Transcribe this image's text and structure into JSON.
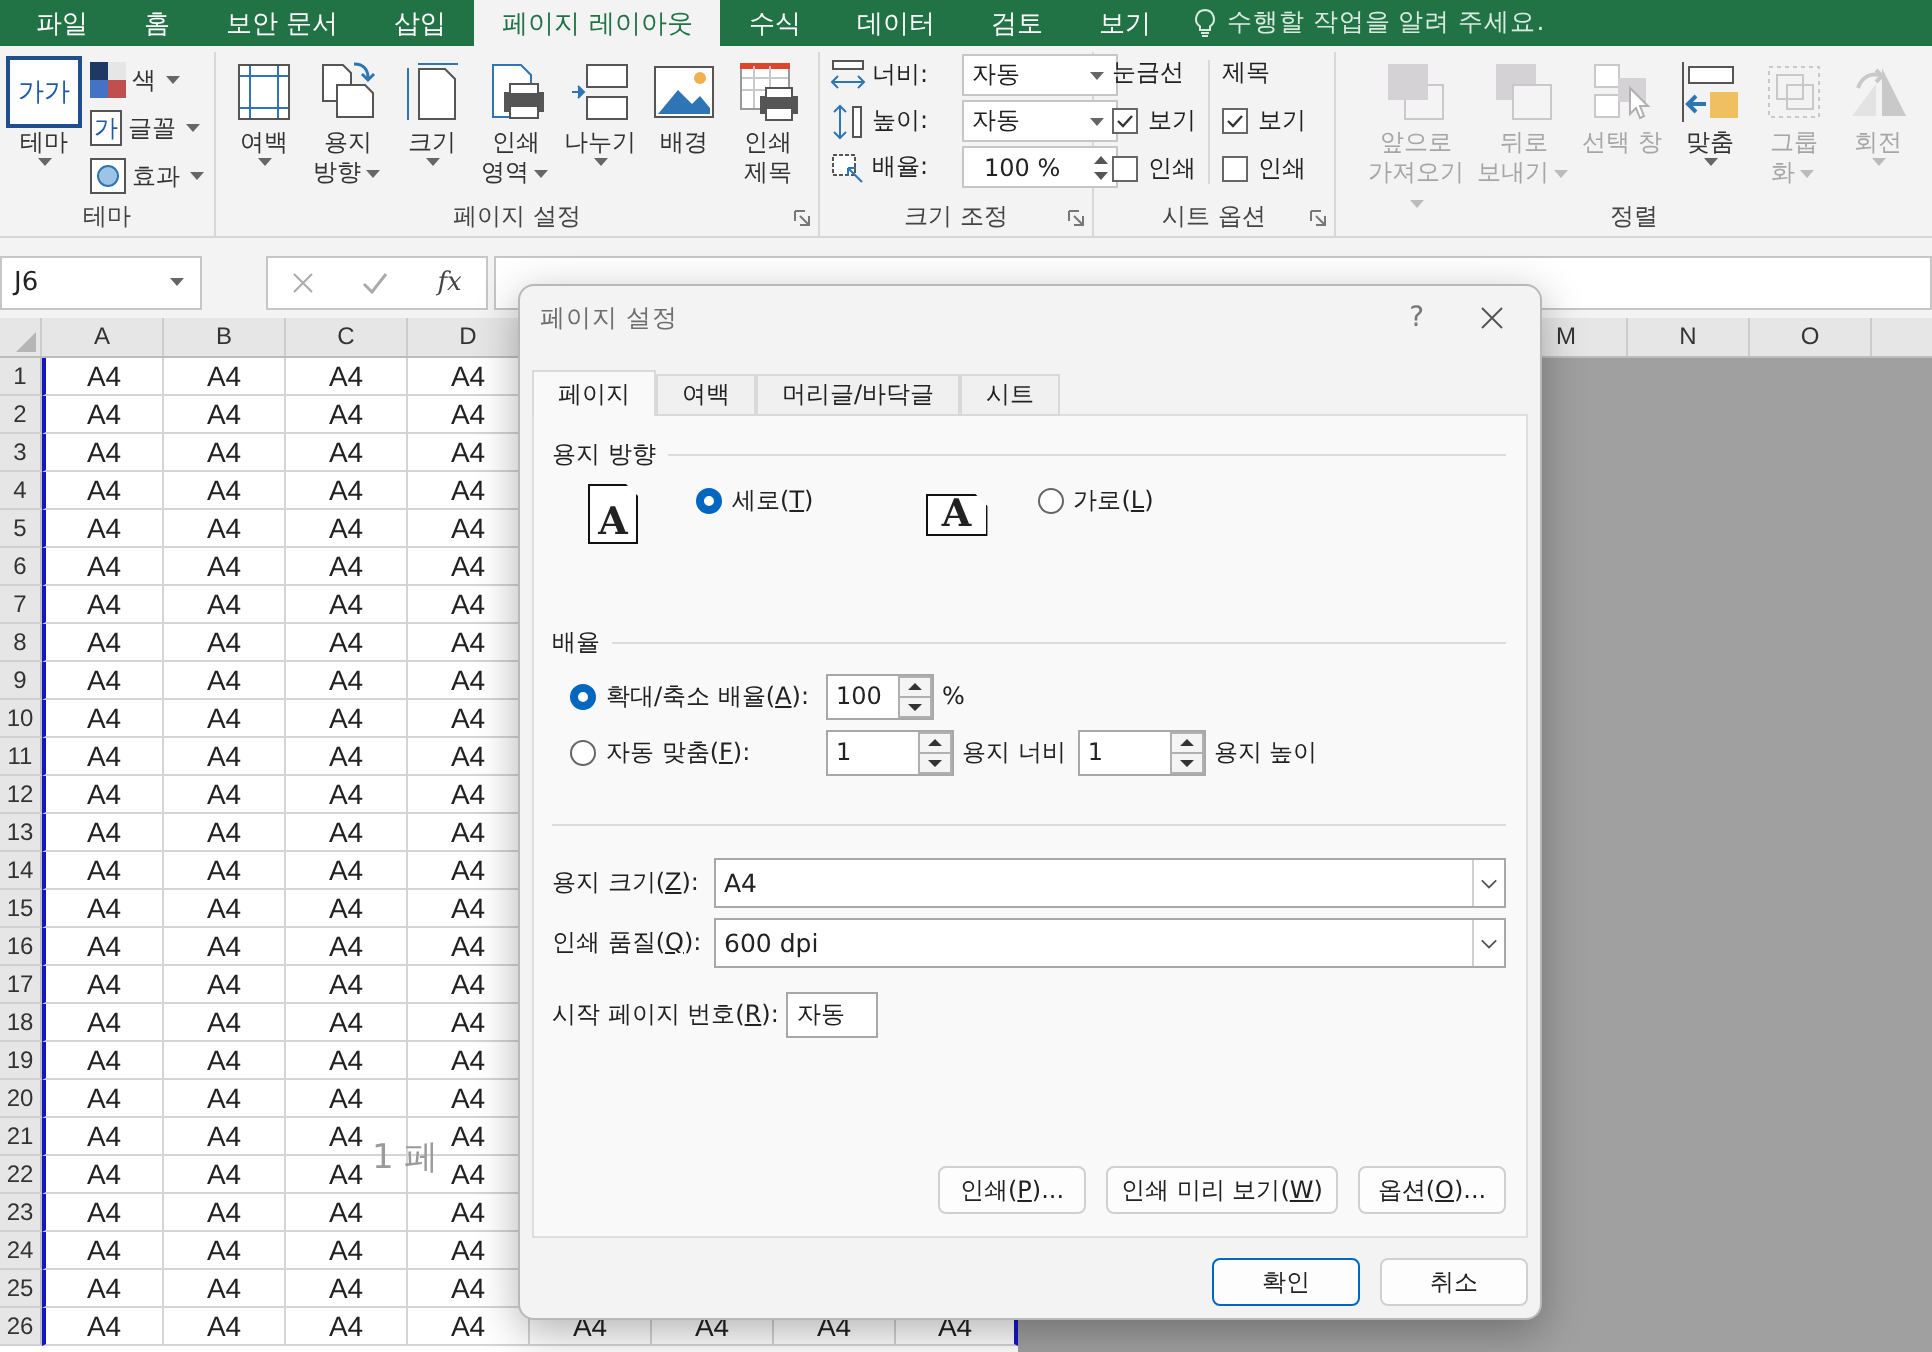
{
  "ribbon_tabs": [
    {
      "label": "파일",
      "selected": false
    },
    {
      "label": "홈",
      "selected": false
    },
    {
      "label": "보안 문서",
      "selected": false
    },
    {
      "label": "삽입",
      "selected": false
    },
    {
      "label": "페이지 레이아웃",
      "selected": true
    },
    {
      "label": "수식",
      "selected": false
    },
    {
      "label": "데이터",
      "selected": false
    },
    {
      "label": "검토",
      "selected": false
    },
    {
      "label": "보기",
      "selected": false
    }
  ],
  "tell_me": "수행할 작업을 알려 주세요.",
  "ribbon": {
    "themes": {
      "title": "테마",
      "main": {
        "label": "테마",
        "icon_text": "가가",
        "dropdown": true
      },
      "options": [
        {
          "label": "색",
          "dropdown": true
        },
        {
          "label": "글꼴",
          "icon_text": "가",
          "dropdown": true
        },
        {
          "label": "효과",
          "dropdown": true
        }
      ]
    },
    "page_setup": {
      "title": "페이지 설정",
      "buttons": [
        {
          "lines": [
            "여백"
          ],
          "dropdown": true
        },
        {
          "lines": [
            "용지",
            "방향"
          ],
          "dropdown": true
        },
        {
          "lines": [
            "크기"
          ],
          "dropdown": true
        },
        {
          "lines": [
            "인쇄",
            "영역"
          ],
          "dropdown": true
        },
        {
          "lines": [
            "나누기"
          ],
          "dropdown": true
        },
        {
          "lines": [
            "배경"
          ],
          "dropdown": false
        },
        {
          "lines": [
            "인쇄",
            "제목"
          ],
          "dropdown": false
        }
      ]
    },
    "scale": {
      "title": "크기 조정",
      "width": {
        "label": "너비:",
        "value": "자동"
      },
      "height": {
        "label": "높이:",
        "value": "자동"
      },
      "zoom": {
        "label": "배율:",
        "value": "100 %"
      }
    },
    "sheet_options": {
      "title": "시트 옵션",
      "columns": [
        {
          "heading": "눈금선",
          "options": [
            {
              "label": "보기",
              "checked": true
            },
            {
              "label": "인쇄",
              "checked": false
            }
          ]
        },
        {
          "heading": "제목",
          "options": [
            {
              "label": "보기",
              "checked": true
            },
            {
              "label": "인쇄",
              "checked": false
            }
          ]
        }
      ]
    },
    "arrange": {
      "title": "정렬",
      "buttons": [
        {
          "lines": [
            "앞으로",
            "가져오기"
          ],
          "dropdown": true,
          "disabled": true
        },
        {
          "lines": [
            "뒤로",
            "보내기"
          ],
          "dropdown": true,
          "disabled": true
        },
        {
          "lines": [
            "선택 창"
          ],
          "dropdown": false,
          "disabled": true
        },
        {
          "lines": [
            "맞춤"
          ],
          "dropdown": true,
          "disabled": false
        },
        {
          "lines": [
            "그룹",
            "화"
          ],
          "dropdown": true,
          "disabled": true
        },
        {
          "lines": [
            "회전"
          ],
          "dropdown": true,
          "disabled": true
        }
      ]
    }
  },
  "sheet": {
    "name_box": "J6",
    "function_label": "fx",
    "column_headers": {
      "left": [
        "A",
        "B",
        "C",
        "D"
      ],
      "right": [
        "M",
        "N",
        "O"
      ]
    },
    "page_label": "1 페",
    "rows": [
      {
        "number": "1",
        "cells": [
          "A4",
          "A4",
          "A4",
          "A4"
        ]
      },
      {
        "number": "2",
        "cells": [
          "A4",
          "A4",
          "A4",
          "A4"
        ]
      },
      {
        "number": "3",
        "cells": [
          "A4",
          "A4",
          "A4",
          "A4"
        ]
      },
      {
        "number": "4",
        "cells": [
          "A4",
          "A4",
          "A4",
          "A4"
        ]
      },
      {
        "number": "5",
        "cells": [
          "A4",
          "A4",
          "A4",
          "A4"
        ]
      },
      {
        "number": "6",
        "cells": [
          "A4",
          "A4",
          "A4",
          "A4"
        ]
      },
      {
        "number": "7",
        "cells": [
          "A4",
          "A4",
          "A4",
          "A4"
        ]
      },
      {
        "number": "8",
        "cells": [
          "A4",
          "A4",
          "A4",
          "A4"
        ]
      },
      {
        "number": "9",
        "cells": [
          "A4",
          "A4",
          "A4",
          "A4"
        ]
      },
      {
        "number": "10",
        "cells": [
          "A4",
          "A4",
          "A4",
          "A4"
        ]
      },
      {
        "number": "11",
        "cells": [
          "A4",
          "A4",
          "A4",
          "A4"
        ]
      },
      {
        "number": "12",
        "cells": [
          "A4",
          "A4",
          "A4",
          "A4"
        ]
      },
      {
        "number": "13",
        "cells": [
          "A4",
          "A4",
          "A4",
          "A4"
        ]
      },
      {
        "number": "14",
        "cells": [
          "A4",
          "A4",
          "A4",
          "A4"
        ]
      },
      {
        "number": "15",
        "cells": [
          "A4",
          "A4",
          "A4",
          "A4"
        ]
      },
      {
        "number": "16",
        "cells": [
          "A4",
          "A4",
          "A4",
          "A4"
        ]
      },
      {
        "number": "17",
        "cells": [
          "A4",
          "A4",
          "A4",
          "A4"
        ]
      },
      {
        "number": "18",
        "cells": [
          "A4",
          "A4",
          "A4",
          "A4"
        ]
      },
      {
        "number": "19",
        "cells": [
          "A4",
          "A4",
          "A4",
          "A4"
        ]
      },
      {
        "number": "20",
        "cells": [
          "A4",
          "A4",
          "A4",
          "A4"
        ]
      },
      {
        "number": "21",
        "cells": [
          "A4",
          "A4",
          "A4",
          "A4"
        ]
      },
      {
        "number": "22",
        "cells": [
          "A4",
          "A4",
          "A4",
          "A4"
        ]
      },
      {
        "number": "23",
        "cells": [
          "A4",
          "A4",
          "A4",
          "A4"
        ]
      },
      {
        "number": "24",
        "cells": [
          "A4",
          "A4",
          "A4",
          "A4"
        ]
      },
      {
        "number": "25",
        "cells": [
          "A4",
          "A4",
          "A4",
          "A4"
        ]
      },
      {
        "number": "26",
        "cells": [
          "A4",
          "A4",
          "A4",
          "A4",
          "A4",
          "A4",
          "A4",
          "A4"
        ]
      }
    ]
  },
  "dialog": {
    "title": "페이지 설정",
    "help": "?",
    "tabs": [
      {
        "label": "페이지",
        "selected": true
      },
      {
        "label": "여백",
        "selected": false
      },
      {
        "label": "머리글/바닥글",
        "selected": false
      },
      {
        "label": "시트",
        "selected": false
      }
    ],
    "orientation": {
      "heading": "용지 방향",
      "options": [
        {
          "glyph": "A",
          "text": "세로(",
          "key": "T",
          "tail": ")",
          "selected": true
        },
        {
          "glyph": "A",
          "text": "가로(",
          "key": "L",
          "tail": ")",
          "selected": false
        }
      ]
    },
    "scaling": {
      "heading": "배율",
      "adjust": {
        "text": "확대/축소 배율(",
        "key": "A",
        "tail": "):",
        "selected": true,
        "value": "100",
        "unit": "%"
      },
      "fit": {
        "text": "자동 맞춤(",
        "key": "F",
        "tail": "):",
        "selected": false,
        "wide_value": "1",
        "wide_label": "용지 너비",
        "tall_value": "1",
        "tall_label": "용지 높이"
      }
    },
    "paper_size": {
      "text": "용지 크기(",
      "key": "Z",
      "tail": "):",
      "value": "A4"
    },
    "print_quality": {
      "text": "인쇄 품질(",
      "key": "Q",
      "tail": "):",
      "value": "600 dpi"
    },
    "first_page": {
      "text": "시작 페이지 번호(",
      "key": "R",
      "tail": "):",
      "value": "자동"
    },
    "buttons": [
      {
        "text": "인쇄(",
        "key": "P",
        "tail": ")..."
      },
      {
        "text": "인쇄 미리 보기(",
        "key": "W",
        "tail": ")"
      },
      {
        "text": "옵션(",
        "key": "O",
        "tail": ")..."
      }
    ],
    "ok": "확인",
    "cancel": "취소"
  }
}
